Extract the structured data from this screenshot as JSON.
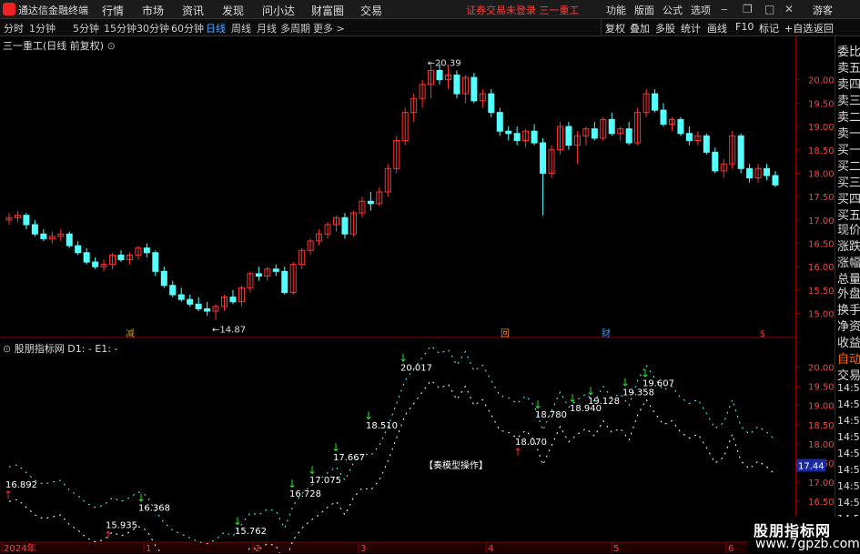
{
  "app": {
    "title": "通达信金融终端",
    "menus": [
      "行情",
      "市场",
      "资讯",
      "发现",
      "问小达",
      "财富圈",
      "交易"
    ],
    "alert": "证券交易未登录  三一重工",
    "right_menus": [
      "功能",
      "版面",
      "公式",
      "选项"
    ],
    "guest": "游客"
  },
  "timeframes": [
    "分时",
    "1分钟",
    "5分钟",
    "15分钟",
    "30分钟",
    "60分钟",
    "日线",
    "周线",
    "月线",
    "多周期",
    "更多 >"
  ],
  "active_timeframe": "日线",
  "toolbar": [
    "复权",
    "叠加",
    "多股",
    "统计",
    "画线",
    "F10",
    "标记",
    "+自选",
    "返回"
  ],
  "main_panel": {
    "title": "三一重工(日线 前复权)",
    "y_ticks": [
      "20.00",
      "19.50",
      "19.00",
      "18.50",
      "18.00",
      "17.50",
      "17.00",
      "16.50",
      "16.00",
      "15.50",
      "15.00"
    ],
    "high_label": "20.39",
    "low_label": "14.87",
    "event_markers": [
      "减",
      "回",
      "财",
      "$"
    ],
    "colors": {
      "up": "#ff3232",
      "down": "#54ffff",
      "bg": "#000000",
      "frame": "#8b0000"
    }
  },
  "indicator_panel": {
    "title": "股朋指标网",
    "params": "D1: -  E1: -",
    "y_ticks": [
      "20.00",
      "19.50",
      "19.00",
      "18.50",
      "18.00",
      "17.50",
      "17.00",
      "16.50",
      "16.00"
    ],
    "price_label": "17.44",
    "caption": "【奏模型操作】",
    "signal_labels": [
      "16.892",
      "15.935",
      "16.368",
      "15.762",
      "16.728",
      "17.075",
      "17.667",
      "18.510",
      "20.017",
      "18.070",
      "18.780",
      "18.940",
      "19.128",
      "19.358",
      "19.607"
    ]
  },
  "x_axis": [
    "2024年",
    "1",
    "2",
    "3",
    "4",
    "5",
    "6"
  ],
  "right_sidebar": [
    "委比",
    "卖五",
    "卖四",
    "卖三",
    "卖二",
    "卖一",
    "买一",
    "买二",
    "买三",
    "买四",
    "买五",
    "现价",
    "涨跌",
    "涨幅",
    "总量",
    "外盘",
    "换手",
    "净资",
    "收益",
    "自动",
    "交易",
    "14:56",
    "14:56",
    "14:56",
    "14:56",
    "14:56",
    "14:56",
    "14:56",
    "14:56",
    "14:56",
    "14:56"
  ],
  "watermark": {
    "line1": "股朋指标网",
    "line2": "www.7gpzb.com"
  },
  "chart_data": {
    "type": "candlestick",
    "title": "三一重工(日线 前复权)",
    "ylim": [
      14.7,
      20.5
    ],
    "candles": [
      [
        17.0,
        17.15,
        16.9,
        17.05
      ],
      [
        17.05,
        17.2,
        16.95,
        17.1
      ],
      [
        17.1,
        17.15,
        16.8,
        16.9
      ],
      [
        16.9,
        17.0,
        16.65,
        16.7
      ],
      [
        16.7,
        16.8,
        16.55,
        16.6
      ],
      [
        16.6,
        16.75,
        16.5,
        16.65
      ],
      [
        16.65,
        16.8,
        16.55,
        16.7
      ],
      [
        16.7,
        16.75,
        16.4,
        16.45
      ],
      [
        16.45,
        16.55,
        16.25,
        16.3
      ],
      [
        16.3,
        16.4,
        16.05,
        16.1
      ],
      [
        16.1,
        16.2,
        15.95,
        16.0
      ],
      [
        16.0,
        16.15,
        15.9,
        16.05
      ],
      [
        16.05,
        16.3,
        15.95,
        16.25
      ],
      [
        16.25,
        16.35,
        16.1,
        16.15
      ],
      [
        16.15,
        16.3,
        16.05,
        16.25
      ],
      [
        16.25,
        16.45,
        16.15,
        16.4
      ],
      [
        16.4,
        16.5,
        16.2,
        16.3
      ],
      [
        16.3,
        16.35,
        15.8,
        15.9
      ],
      [
        15.9,
        16.0,
        15.55,
        15.6
      ],
      [
        15.6,
        15.7,
        15.35,
        15.4
      ],
      [
        15.4,
        15.55,
        15.25,
        15.3
      ],
      [
        15.3,
        15.4,
        15.15,
        15.2
      ],
      [
        15.2,
        15.35,
        15.05,
        15.1
      ],
      [
        15.1,
        15.25,
        14.95,
        15.05
      ],
      [
        15.05,
        15.2,
        14.87,
        15.15
      ],
      [
        15.15,
        15.4,
        15.05,
        15.35
      ],
      [
        15.35,
        15.5,
        15.2,
        15.25
      ],
      [
        15.25,
        15.6,
        15.15,
        15.55
      ],
      [
        15.55,
        15.9,
        15.45,
        15.85
      ],
      [
        15.85,
        16.0,
        15.7,
        15.8
      ],
      [
        15.8,
        16.0,
        15.7,
        15.95
      ],
      [
        15.95,
        16.05,
        15.8,
        15.9
      ],
      [
        15.9,
        16.0,
        15.4,
        15.45
      ],
      [
        15.45,
        16.1,
        15.4,
        16.05
      ],
      [
        16.05,
        16.4,
        15.95,
        16.35
      ],
      [
        16.35,
        16.6,
        16.25,
        16.55
      ],
      [
        16.55,
        16.8,
        16.45,
        16.7
      ],
      [
        16.7,
        16.95,
        16.6,
        16.9
      ],
      [
        16.9,
        17.1,
        16.75,
        17.05
      ],
      [
        17.05,
        17.15,
        16.6,
        16.7
      ],
      [
        16.7,
        17.2,
        16.65,
        17.15
      ],
      [
        17.15,
        17.5,
        17.05,
        17.4
      ],
      [
        17.4,
        17.6,
        17.2,
        17.35
      ],
      [
        17.35,
        17.7,
        17.3,
        17.6
      ],
      [
        17.6,
        18.2,
        17.5,
        18.1
      ],
      [
        18.1,
        18.8,
        18.0,
        18.7
      ],
      [
        18.7,
        19.4,
        18.6,
        19.3
      ],
      [
        19.3,
        19.7,
        19.1,
        19.6
      ],
      [
        19.6,
        20.0,
        19.4,
        19.9
      ],
      [
        19.9,
        20.39,
        19.6,
        20.2
      ],
      [
        20.2,
        20.35,
        19.9,
        20.0
      ],
      [
        20.0,
        20.3,
        19.8,
        20.1
      ],
      [
        20.1,
        20.2,
        19.6,
        19.7
      ],
      [
        19.7,
        20.1,
        19.5,
        20.05
      ],
      [
        20.05,
        20.15,
        19.5,
        19.55
      ],
      [
        19.55,
        19.8,
        19.4,
        19.7
      ],
      [
        19.7,
        19.8,
        19.2,
        19.3
      ],
      [
        19.3,
        19.4,
        18.8,
        18.9
      ],
      [
        18.9,
        19.0,
        18.7,
        18.85
      ],
      [
        18.85,
        19.0,
        18.6,
        18.7
      ],
      [
        18.7,
        18.95,
        18.55,
        18.9
      ],
      [
        18.9,
        19.05,
        18.6,
        18.65
      ],
      [
        18.65,
        18.75,
        17.1,
        18.0
      ],
      [
        18.0,
        18.6,
        17.9,
        18.5
      ],
      [
        18.5,
        19.1,
        18.4,
        19.0
      ],
      [
        19.0,
        19.1,
        18.5,
        18.6
      ],
      [
        18.6,
        18.9,
        18.2,
        18.8
      ],
      [
        18.8,
        19.0,
        18.6,
        18.95
      ],
      [
        18.95,
        19.1,
        18.7,
        18.75
      ],
      [
        18.75,
        19.2,
        18.7,
        19.15
      ],
      [
        19.15,
        19.3,
        18.8,
        18.85
      ],
      [
        18.85,
        19.0,
        18.7,
        18.95
      ],
      [
        18.95,
        19.1,
        18.6,
        18.65
      ],
      [
        18.65,
        19.4,
        18.6,
        19.3
      ],
      [
        19.3,
        19.8,
        19.2,
        19.7
      ],
      [
        19.7,
        19.8,
        19.3,
        19.35
      ],
      [
        19.35,
        19.5,
        19.0,
        19.05
      ],
      [
        19.05,
        19.2,
        18.9,
        19.15
      ],
      [
        19.15,
        19.2,
        18.8,
        18.85
      ],
      [
        18.85,
        19.0,
        18.6,
        18.7
      ],
      [
        18.7,
        18.9,
        18.6,
        18.8
      ],
      [
        18.8,
        18.85,
        18.4,
        18.45
      ],
      [
        18.45,
        18.55,
        18.0,
        18.05
      ],
      [
        18.05,
        18.3,
        17.9,
        18.2
      ],
      [
        18.2,
        18.9,
        18.1,
        18.8
      ],
      [
        18.8,
        18.85,
        18.0,
        18.1
      ],
      [
        18.1,
        18.2,
        17.8,
        17.9
      ],
      [
        17.9,
        18.2,
        17.8,
        18.1
      ],
      [
        18.1,
        18.2,
        17.85,
        17.95
      ],
      [
        17.95,
        18.05,
        17.7,
        17.75
      ]
    ]
  }
}
